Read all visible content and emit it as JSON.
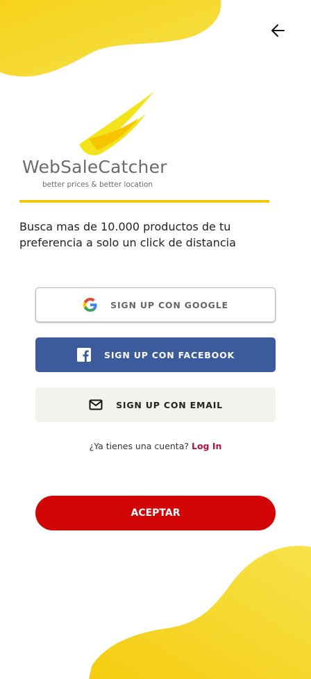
{
  "header": {
    "back_icon": "arrow-left-icon"
  },
  "logo": {
    "name": "WebSaleCatcher",
    "tagline": "better prices & better location",
    "accent_color": "#f2c80f"
  },
  "description": "Busca mas de 10.000 productos de tu preferencia a solo un click de distancia",
  "buttons": {
    "google": {
      "label": "SIGN UP CON GOOGLE",
      "icon": "google-icon"
    },
    "facebook": {
      "label": "SIGN UP CON FACEBOOK",
      "icon": "facebook-icon",
      "color": "#3b5b9d"
    },
    "email": {
      "label": "SIGN UP CON EMAIL",
      "icon": "mail-icon"
    }
  },
  "login": {
    "prompt": "¿Ya tienes una cuenta?",
    "link": "Log In",
    "link_color": "#b80c3f"
  },
  "accept": {
    "label": "ACEPTAR",
    "color": "#d20505"
  }
}
